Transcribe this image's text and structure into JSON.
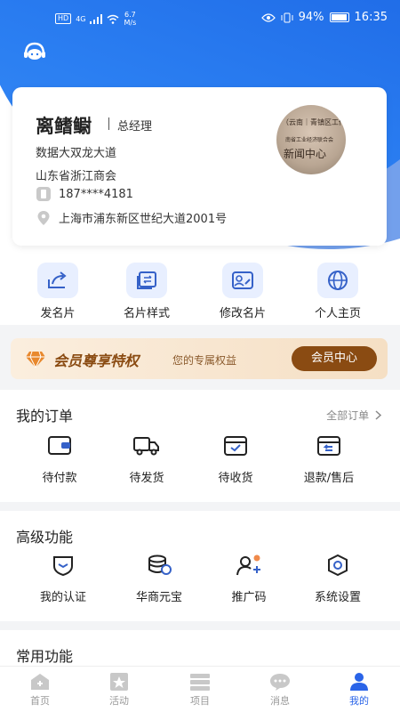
{
  "status_bar": {
    "network": "HD",
    "signal": "4G",
    "speed_value": "6.7",
    "speed_unit": "M/s",
    "battery": "94%",
    "time": "16:35"
  },
  "profile": {
    "name": "离鳍鳚",
    "title": "总经理",
    "company": "数据大双龙大道",
    "org": "山东省浙江商会",
    "phone": "187****4181",
    "address": "上海市浦东新区世纪大道2001号",
    "avatar_text_top": "（云南｜青镇区工作",
    "avatar_text_mid": "南省工业经济联合会",
    "avatar_text_bottom": "新闻中心"
  },
  "quick_actions": [
    {
      "label": "发名片",
      "icon": "share-icon"
    },
    {
      "label": "名片样式",
      "icon": "card-style-icon"
    },
    {
      "label": "修改名片",
      "icon": "edit-card-icon"
    },
    {
      "label": "个人主页",
      "icon": "globe-icon"
    }
  ],
  "vip": {
    "title": "会员尊享特权",
    "subtitle": "您的专属权益",
    "button": "会员中心"
  },
  "orders": {
    "title": "我的订单",
    "more": "全部订单",
    "items": [
      {
        "label": "待付款",
        "icon": "wallet-icon"
      },
      {
        "label": "待发货",
        "icon": "truck-icon"
      },
      {
        "label": "待收货",
        "icon": "box-icon"
      },
      {
        "label": "退款/售后",
        "icon": "refund-icon"
      }
    ]
  },
  "advanced": {
    "title": "高级功能",
    "items": [
      {
        "label": "我的认证",
        "icon": "shield-icon"
      },
      {
        "label": "华商元宝",
        "icon": "coins-icon"
      },
      {
        "label": "推广码",
        "icon": "user-add-icon"
      },
      {
        "label": "系统设置",
        "icon": "gear-icon"
      }
    ]
  },
  "common": {
    "title": "常用功能"
  },
  "tabs": [
    {
      "label": "首页",
      "icon": "home-icon"
    },
    {
      "label": "活动",
      "icon": "star-icon"
    },
    {
      "label": "项目",
      "icon": "stack-icon"
    },
    {
      "label": "消息",
      "icon": "chat-icon"
    },
    {
      "label": "我的",
      "icon": "user-icon"
    }
  ],
  "colors": {
    "brand_blue": "#1f6fee",
    "vip_brown": "#8a4b12",
    "active_tab": "#2a64e8"
  }
}
